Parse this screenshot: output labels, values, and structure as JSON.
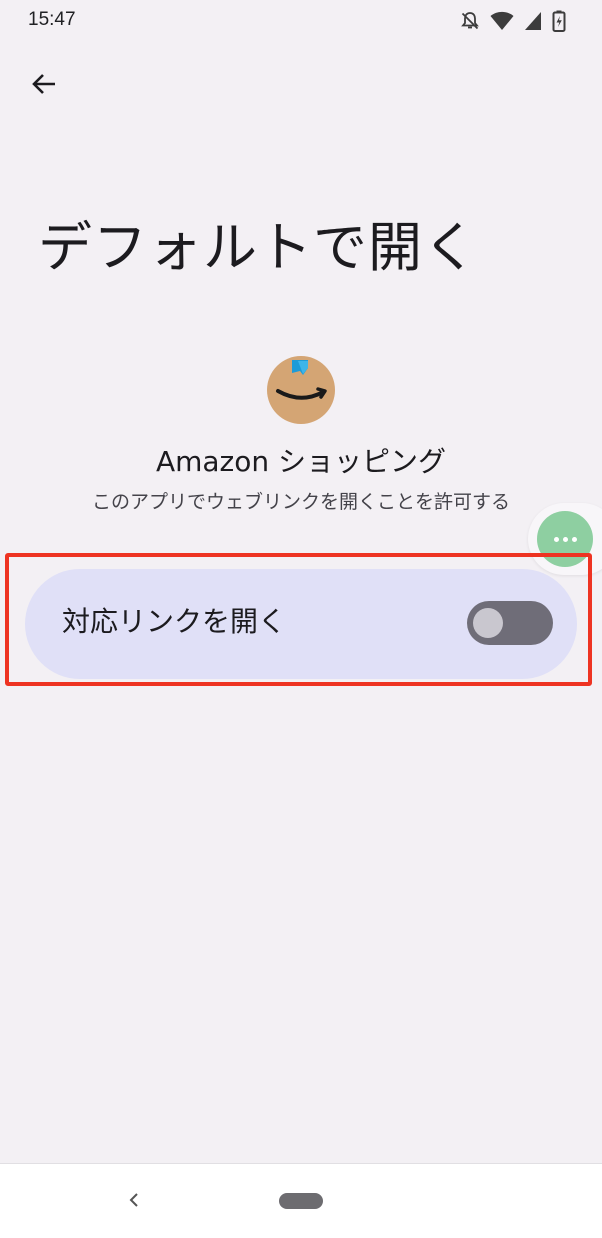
{
  "status_bar": {
    "time": "15:47",
    "icons": [
      "mute-icon",
      "wifi-icon",
      "signal-icon",
      "battery-charging-icon"
    ]
  },
  "header": {
    "back_icon": "arrow-back-icon"
  },
  "page": {
    "title": "デフォルトで開く"
  },
  "app": {
    "icon": "amazon-shopping-icon",
    "name": "Amazon ショッピング",
    "subtitle": "このアプリでウェブリンクを開くことを許可する"
  },
  "setting": {
    "label": "対応リンクを開く",
    "toggle_on": false
  },
  "floating_menu": {
    "icon": "more-dots-icon"
  },
  "nav": {
    "back_icon": "nav-back-icon",
    "home_icon": "home-pill-icon"
  },
  "colors": {
    "background": "#f3f0f4",
    "row_background": "#e0e0f7",
    "highlight": "#ee3322",
    "toggle_track": "#6f6d78",
    "float_button": "#8ecfa1"
  }
}
